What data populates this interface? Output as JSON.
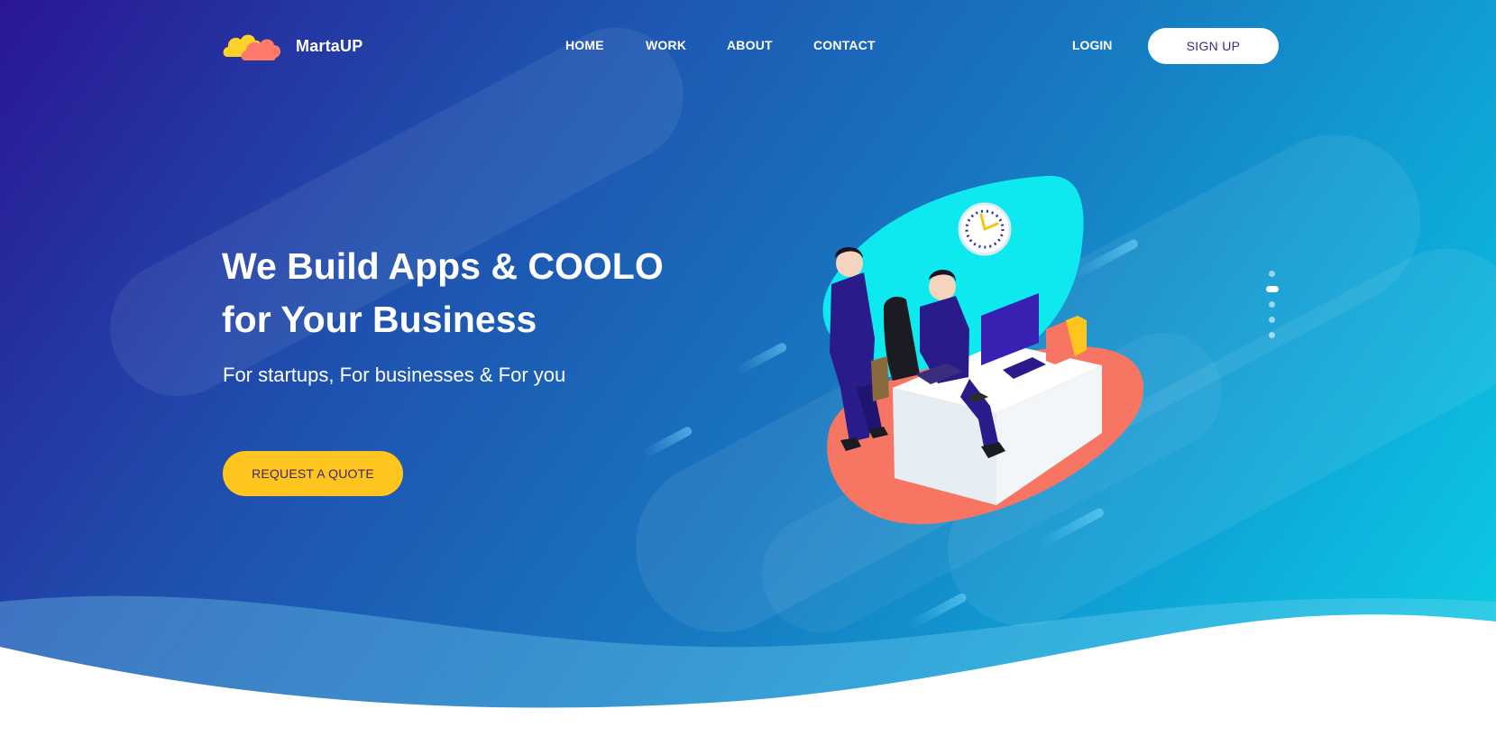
{
  "brand": {
    "name": "MartaUP",
    "logo_icon": "cloud-logo-icon"
  },
  "nav": {
    "items": [
      "HOME",
      "WORK",
      "ABOUT",
      "CONTACT"
    ],
    "login_label": "LOGIN",
    "signup_label": "SIGN UP"
  },
  "hero": {
    "headline_line1": "We Build Apps & COOLO",
    "headline_line2": "for Your Business",
    "subheading": "For startups, For businesses & For you",
    "cta_label": "REQUEST A QUOTE",
    "illustration": "office-desk-illustration-icon"
  },
  "slider": {
    "count": 5,
    "active_index": 1
  },
  "colors": {
    "cta": "#ffc41e",
    "gradient_start": "#2a1694",
    "gradient_end": "#0bd2e6",
    "platform": "#f77563",
    "backdrop": "#0ee8ef"
  }
}
